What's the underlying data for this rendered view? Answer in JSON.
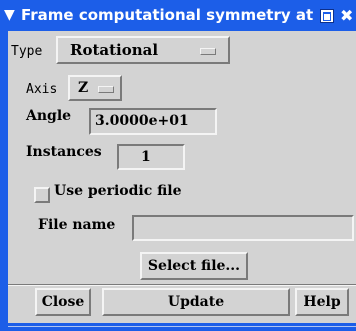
{
  "window": {
    "title": "Frame computational symmetry at",
    "menu_icon": "chevron-down-icon",
    "maximize_icon": "maximize-icon",
    "close_icon": "close-icon"
  },
  "form": {
    "type_label": "Type",
    "type_value": "Rotational",
    "axis_label": "Axis",
    "axis_value": "Z",
    "angle_label": "Angle",
    "angle_value": "3.0000e+01",
    "instances_label": "Instances",
    "instances_value": "1",
    "periodic_label": "Use periodic file",
    "periodic_checked": false,
    "file_name_label": "File name",
    "file_name_value": "",
    "select_file_label": "Select file..."
  },
  "buttons": {
    "close": "Close",
    "update": "Update",
    "help": "Help"
  },
  "colors": {
    "titlebar": "#1c5ee8",
    "background": "#d3d3d3"
  }
}
